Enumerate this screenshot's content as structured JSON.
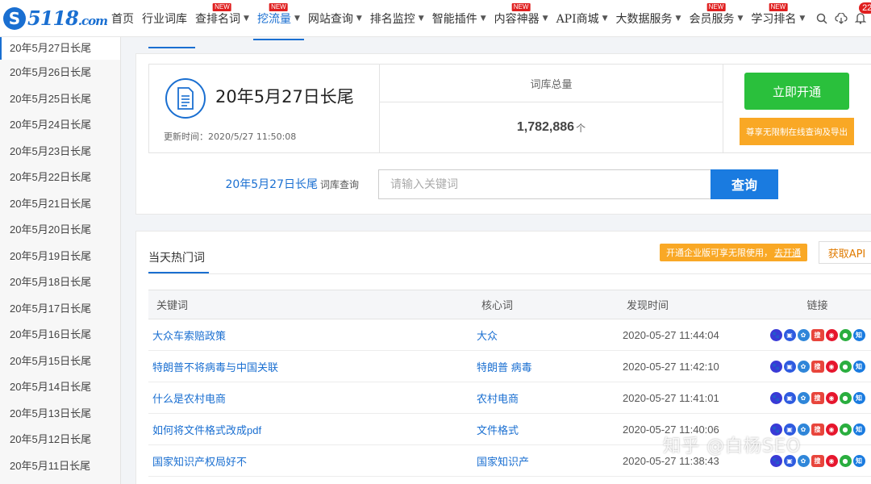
{
  "brand": {
    "logo_mark": "S",
    "logo_text": "5118",
    "logo_domain": ".com"
  },
  "nav": {
    "items": [
      {
        "label": "首页",
        "dropdown": false,
        "new": false,
        "active": false
      },
      {
        "label": "行业词库",
        "dropdown": false,
        "new": false,
        "active": false
      },
      {
        "label": "查排名词",
        "dropdown": true,
        "new": true,
        "active": false
      },
      {
        "label": "挖流量",
        "dropdown": true,
        "new": true,
        "active": true
      },
      {
        "label": "网站查询",
        "dropdown": true,
        "new": false,
        "active": false
      },
      {
        "label": "排名监控",
        "dropdown": true,
        "new": false,
        "active": false
      },
      {
        "label": "智能插件",
        "dropdown": true,
        "new": false,
        "active": false
      },
      {
        "label": "内容神器",
        "dropdown": true,
        "new": true,
        "active": false
      },
      {
        "label": "API商城",
        "dropdown": true,
        "new": false,
        "active": false
      },
      {
        "label": "大数据服务",
        "dropdown": true,
        "new": false,
        "active": false
      },
      {
        "label": "会员服务",
        "dropdown": true,
        "new": true,
        "active": false
      },
      {
        "label": "学习排名",
        "dropdown": true,
        "new": true,
        "active": false
      }
    ],
    "new_badge": "NEW",
    "notification_count": "22"
  },
  "sidebar": {
    "items": [
      "20年5月27日长尾",
      "20年5月26日长尾",
      "20年5月25日长尾",
      "20年5月24日长尾",
      "20年5月23日长尾",
      "20年5月22日长尾",
      "20年5月21日长尾",
      "20年5月20日长尾",
      "20年5月19日长尾",
      "20年5月18日长尾",
      "20年5月17日长尾",
      "20年5月16日长尾",
      "20年5月15日长尾",
      "20年5月14日长尾",
      "20年5月13日长尾",
      "20年5月12日长尾",
      "20年5月11日长尾"
    ]
  },
  "summary": {
    "title": "20年5月27日长尾",
    "updated": "更新时间：2020/5/27 11:50:08",
    "total_label": "词库总量",
    "total_value": "1,782,886",
    "total_unit": "个",
    "open_button": "立即开通",
    "open_note": "尊享无限制在线查询及导出"
  },
  "search": {
    "label_link": "20年5月27日长尾",
    "label_suffix": "词库查询",
    "placeholder": "请输入关键词",
    "button": "查询"
  },
  "hot": {
    "title": "当天热门词",
    "enterprise_note": "开通企业版可享无限使用，",
    "enterprise_link": "去开通",
    "api_button": "获取API",
    "columns": [
      "关键词",
      "核心词",
      "发现时间",
      "链接"
    ],
    "rows": [
      {
        "keyword": "大众车索赔政策",
        "core": "大众",
        "time": "2020-05-27 11:44:04"
      },
      {
        "keyword": "特朗普不将病毒与中国关联",
        "core": "特朗普 病毒",
        "time": "2020-05-27 11:42:10"
      },
      {
        "keyword": "什么是农村电商",
        "core": "农村电商",
        "time": "2020-05-27 11:41:01"
      },
      {
        "keyword": "如何将文件格式改成pdf",
        "core": "文件格式",
        "time": "2020-05-27 11:40:06"
      },
      {
        "keyword": "国家知识产权局好不",
        "core": "国家知识产",
        "time": "2020-05-27 11:38:43"
      }
    ],
    "link_icons": [
      {
        "name": "baidu-icon",
        "glyph": "🐾",
        "color": "#3a3ad6"
      },
      {
        "name": "mobile-baidu-icon",
        "glyph": "▣",
        "color": "#2e5be0"
      },
      {
        "name": "360-icon",
        "glyph": "✿",
        "color": "#2f86d9"
      },
      {
        "name": "sogou-icon",
        "glyph": "搜",
        "color": "#e8453c"
      },
      {
        "name": "weibo-icon",
        "glyph": "◉",
        "color": "#e6162d"
      },
      {
        "name": "wechat-icon",
        "glyph": "●",
        "color": "#2aae3f"
      },
      {
        "name": "zhihu-icon",
        "glyph": "知",
        "color": "#1a7be0"
      }
    ]
  },
  "watermark": "知乎 @白杨SEO"
}
